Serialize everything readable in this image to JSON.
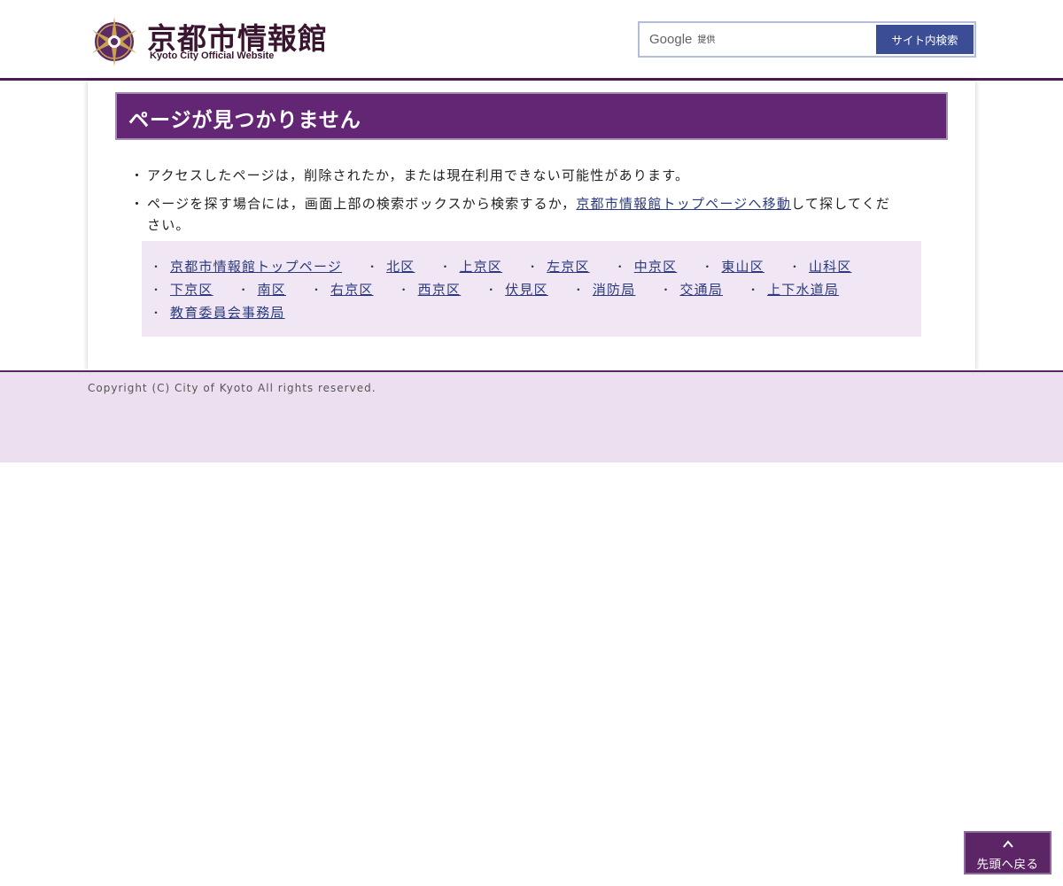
{
  "header": {
    "logo_title": "京都市情報館",
    "logo_subtitle": "Kyoto City Official Website",
    "search": {
      "brand": "Google",
      "provided": "提供",
      "button_label": "サイト内検索"
    }
  },
  "main": {
    "heading": "ページが見つかりません",
    "notes": [
      {
        "text": "アクセスしたページは，削除されたか，または現在利用できない可能性があります。"
      },
      {
        "text_before": "ページを探す場合には，画面上部の検索ボックスから検索するか，",
        "link": "京都市情報館トップページへ移動",
        "text_after": "して探してください。"
      }
    ],
    "links": [
      "京都市情報館トップページ",
      "北区",
      "上京区",
      "左京区",
      "中京区",
      "東山区",
      "山科区",
      "下京区",
      "南区",
      "右京区",
      "西京区",
      "伏見区",
      "消防局",
      "交通局",
      "上下水道局",
      "教育委員会事務局"
    ]
  },
  "footer": {
    "copyright": "Copyright (C) City of Kyoto All rights reserved."
  },
  "back_to_top": {
    "label": "先頭へ戻る"
  },
  "colors": {
    "brand_purple": "#632674",
    "footer_bg": "#ece0f0",
    "links_bg": "#f0e6f4",
    "search_button": "#3a4d95",
    "link": "#2b3a7e"
  }
}
